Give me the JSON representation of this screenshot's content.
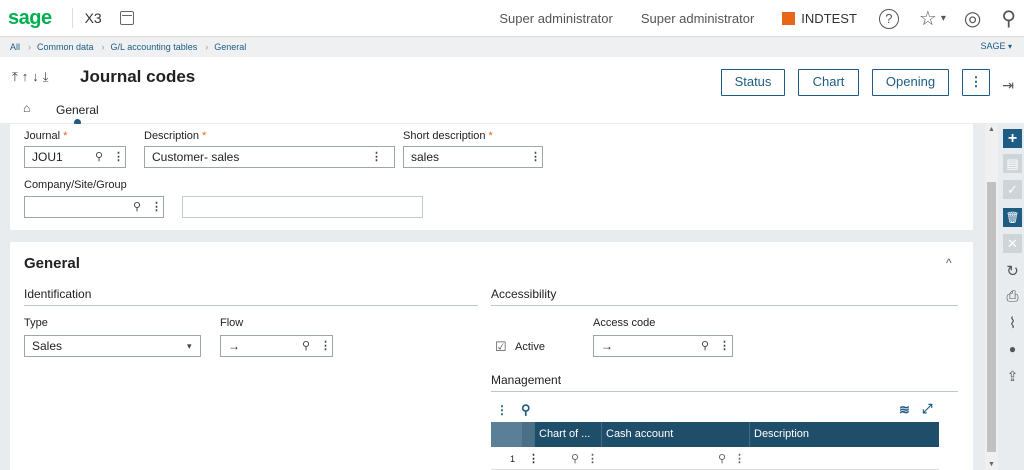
{
  "topbar": {
    "logo": "sage",
    "app": "X3",
    "user1": "Super administrator",
    "user2": "Super administrator",
    "folder": "INDTEST",
    "help": "?",
    "star": "☆",
    "caret": "▾",
    "compass": "◎",
    "search": "⚲"
  },
  "breadcrumb": [
    "All",
    "Common data",
    "G/L accounting tables",
    "General"
  ],
  "breadcrumb_sep": "›",
  "site": "SAGE",
  "site_caret": "▾",
  "page": {
    "nav_arrows": "⤒↑↓⤓",
    "title": "Journal codes",
    "buttons": {
      "status": "Status",
      "chart": "Chart",
      "opening": "Opening",
      "more": "⋮"
    },
    "home": "⌂",
    "tab": "General",
    "exit": "⇥"
  },
  "side_actions": {
    "add": "+",
    "copy": "▤",
    "ok": "✓",
    "delete": "🗑",
    "cancel": "✕",
    "refresh": "↻",
    "print": "⎙",
    "attach": "⌇",
    "comment": "●",
    "export": "⇪"
  },
  "header_card": {
    "journal_label": "Journal",
    "journal_value": "JOU1",
    "desc_label": "Description",
    "desc_value": "Customer- sales",
    "short_label": "Short description",
    "short_value": "sales",
    "company_label": "Company/Site/Group",
    "company_value": "",
    "company_desc": "",
    "req": "*",
    "search_icon": "⚲",
    "menu_icon": "⋮"
  },
  "general": {
    "title": "General",
    "collapse": "^",
    "identification": "Identification",
    "accessibility": "Accessibility",
    "type_label": "Type",
    "type_value": "Sales",
    "select_caret": "▾",
    "flow_label": "Flow",
    "flow_value": "→",
    "active_label": "Active",
    "active_check": "☑",
    "access_label": "Access code",
    "access_value": "→",
    "management": "Management"
  },
  "grid": {
    "toolbar_menu": "⋮",
    "toolbar_search": "⚲",
    "layers": "≋",
    "expand": "⤢",
    "columns": [
      "Chart of ...",
      "Cash account",
      "Description"
    ],
    "rows": [
      {
        "num": "1",
        "chart": "",
        "cash": "",
        "desc": ""
      }
    ]
  }
}
